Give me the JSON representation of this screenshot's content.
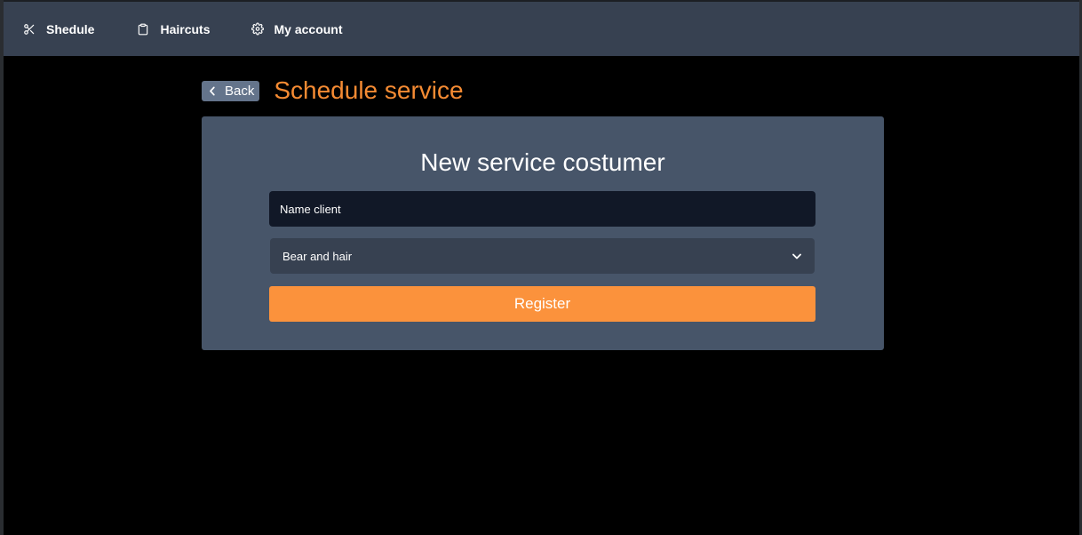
{
  "navbar": {
    "items": [
      {
        "label": "Shedule",
        "icon": "scissors-icon"
      },
      {
        "label": "Haircuts",
        "icon": "clipboard-icon"
      },
      {
        "label": "My account",
        "icon": "gear-icon"
      }
    ]
  },
  "header": {
    "back_label": "Back",
    "back_icon": "chevron-left-icon",
    "title": "Schedule service"
  },
  "form": {
    "title": "New service costumer",
    "name_placeholder": "Name client",
    "name_value": "",
    "service_selected": "Bear and hair",
    "select_icon": "chevron-down-icon",
    "submit_label": "Register"
  },
  "colors": {
    "navbar_bg": "#374151",
    "accent": "#f58b33",
    "button_orange": "#fb923c",
    "card_bg": "#475569",
    "input_bg": "#111827",
    "back_button_bg": "#64748b"
  }
}
